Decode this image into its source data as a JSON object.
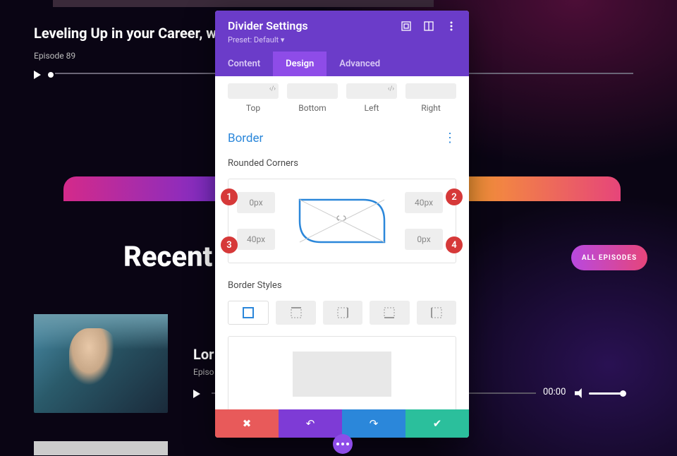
{
  "career": {
    "title": "Leveling Up in your Career, w",
    "sub": "Episode 89"
  },
  "recent": "Recent",
  "all_episodes": "ALL EPISODES",
  "episode2": {
    "title": "Lor",
    "sub": "Episo",
    "time": "00:00"
  },
  "panel": {
    "title": "Divider Settings",
    "preset": "Preset: Default ▾",
    "tabs": {
      "content": "Content",
      "design": "Design",
      "advanced": "Advanced"
    },
    "spacing": {
      "top": "Top",
      "bottom": "Bottom",
      "left": "Left",
      "right": "Right"
    },
    "border_section": "Border",
    "rounded_label": "Rounded Corners",
    "corners": {
      "tl": "0px",
      "tr": "40px",
      "bl": "40px",
      "br": "0px"
    },
    "border_styles_label": "Border Styles"
  },
  "badges": {
    "b1": "1",
    "b2": "2",
    "b3": "3",
    "b4": "4"
  }
}
